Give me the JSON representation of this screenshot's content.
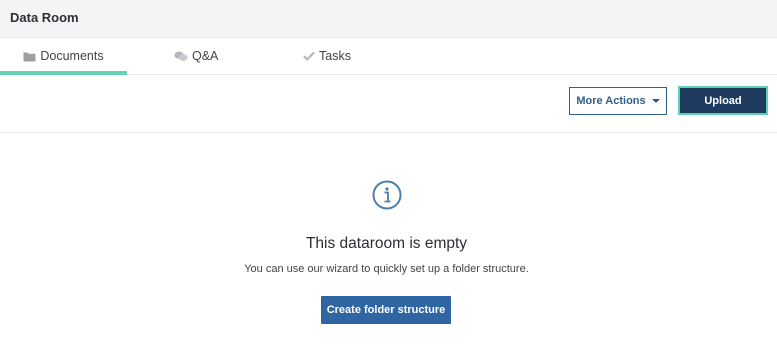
{
  "header": {
    "title": "Data Room"
  },
  "tabs": [
    {
      "label": "Documents",
      "icon": "folder-icon",
      "active": true
    },
    {
      "label": "Q&A",
      "icon": "chat-bubbles-icon",
      "active": false
    },
    {
      "label": "Tasks",
      "icon": "checkmark-icon",
      "active": false
    }
  ],
  "toolbar": {
    "more_actions_label": "More Actions",
    "upload_label": "Upload"
  },
  "empty_state": {
    "icon": "info-icon",
    "heading": "This dataroom is empty",
    "message": "You can use our wizard to quickly set up a folder structure.",
    "create_label": "Create folder structure"
  },
  "colors": {
    "accent_tab": "#62d3b4",
    "primary_dark": "#1e3a5f",
    "primary": "#2f65a3",
    "outline": "#2f5d8c",
    "info_icon": "#4a7fad"
  }
}
